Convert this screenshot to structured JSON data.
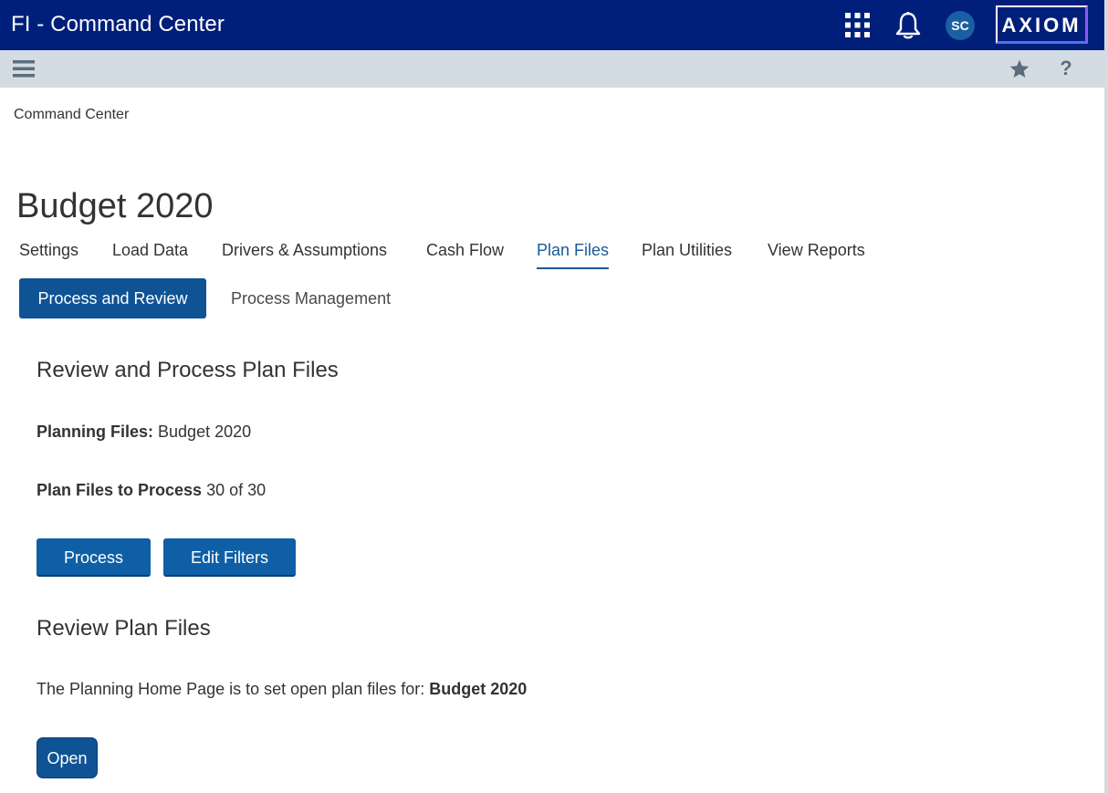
{
  "header": {
    "app_title": "FI - Command Center",
    "avatar_initials": "SC",
    "logo_text": "AXIOM",
    "icons": [
      "apps-grid-icon",
      "bell-icon"
    ]
  },
  "toolbar": {
    "icons": [
      "hamburger-menu-icon",
      "star-icon"
    ],
    "help_label": "?"
  },
  "breadcrumb": "Command Center",
  "page_title": "Budget 2020",
  "tabs": [
    {
      "label": "Settings",
      "active": false
    },
    {
      "label": "Load Data",
      "active": false
    },
    {
      "label": "Drivers & Assumptions",
      "active": false
    },
    {
      "label": "Cash Flow",
      "active": false
    },
    {
      "label": "Plan Files",
      "active": true
    },
    {
      "label": "Plan Utilities",
      "active": false
    },
    {
      "label": "View Reports",
      "active": false
    }
  ],
  "subtabs": [
    {
      "label": "Process and Review",
      "active": true
    },
    {
      "label": "Process Management",
      "active": false
    }
  ],
  "review_process": {
    "title": "Review and Process Plan Files",
    "planning_files_label": "Planning Files:",
    "planning_files_value": "Budget 2020",
    "plan_files_to_process_label": "Plan Files to Process",
    "plan_files_to_process_value": "30 of 30",
    "process_button": "Process",
    "edit_filters_button": "Edit Filters"
  },
  "review_plan_files": {
    "title": "Review Plan Files",
    "description": "The Planning Home Page is to set open plan files for:",
    "description_value": "Budget 2020",
    "open_button": "Open"
  },
  "colors": {
    "header_bg": "#001f7a",
    "toolbar_bg": "#d4dce3",
    "primary_button": "#0f5fa6",
    "active_tab": "#1a5a96"
  }
}
